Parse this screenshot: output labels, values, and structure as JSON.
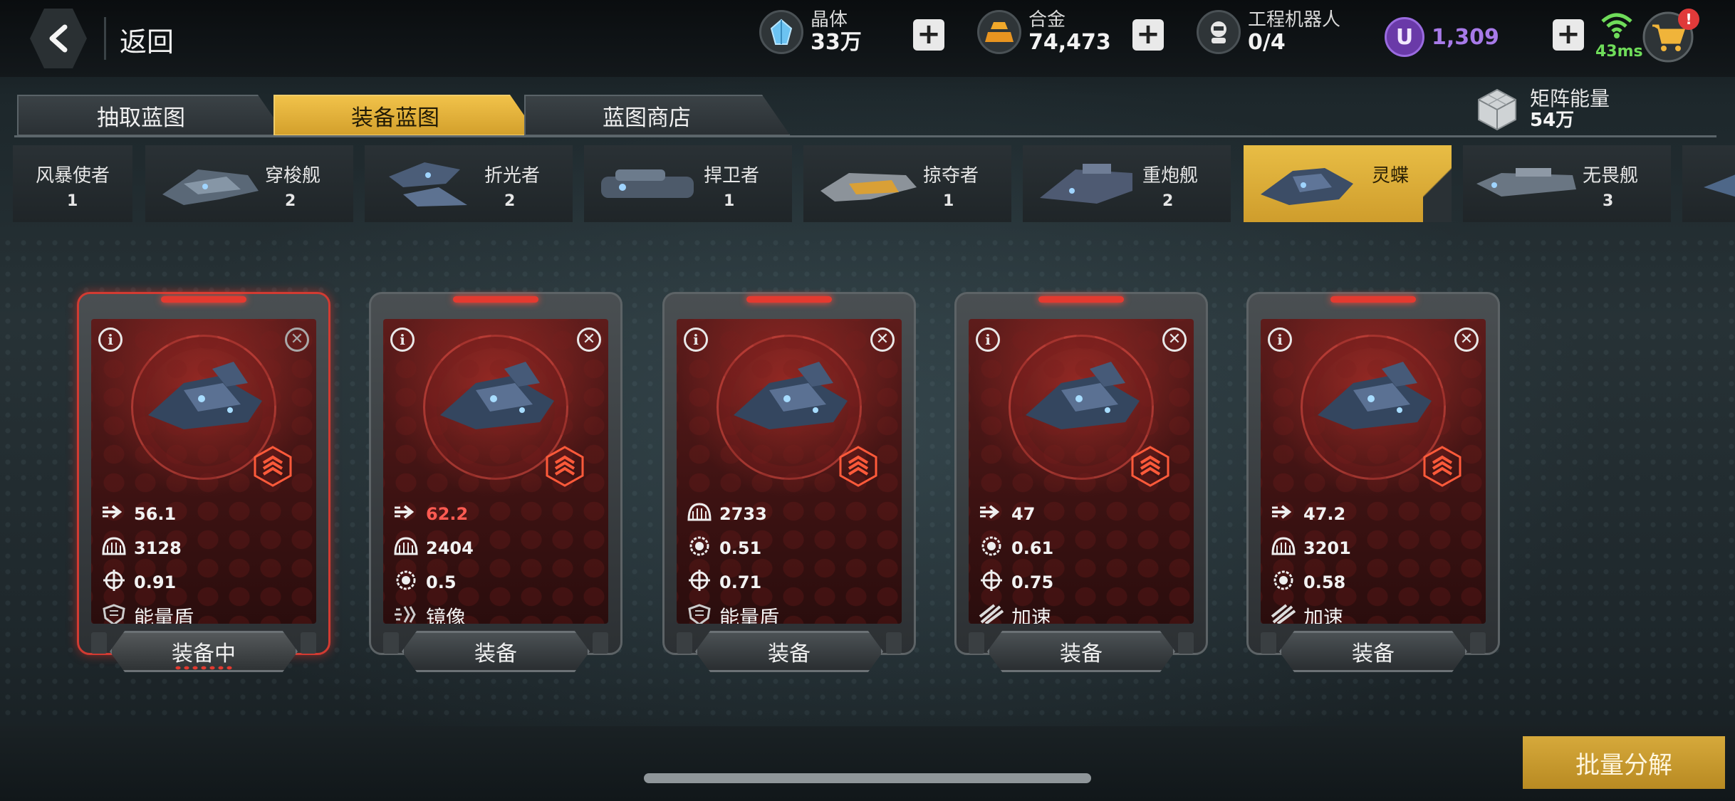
{
  "header": {
    "back_label": "返回",
    "resources": [
      {
        "name": "晶体",
        "value": "33万",
        "icon": "crystal-icon"
      },
      {
        "name": "合金",
        "value": "74,473",
        "icon": "alloy-icon"
      },
      {
        "name": "工程机器人",
        "value": "0/4",
        "icon": "robot-icon"
      }
    ],
    "premium": {
      "symbol": "U",
      "value": "1,309"
    },
    "plus": "+",
    "ping": "43ms",
    "cart_badge": "!"
  },
  "tabs": [
    {
      "label": "抽取蓝图",
      "active": false
    },
    {
      "label": "装备蓝图",
      "active": true
    },
    {
      "label": "蓝图商店",
      "active": false
    }
  ],
  "matrix_energy": {
    "name": "矩阵能量",
    "value": "54万"
  },
  "ships": [
    {
      "name": "风暴使者",
      "count": "1"
    },
    {
      "name": "穿梭舰",
      "count": "2"
    },
    {
      "name": "折光者",
      "count": "2"
    },
    {
      "name": "捍卫者",
      "count": "1"
    },
    {
      "name": "掠夺者",
      "count": "1"
    },
    {
      "name": "重炮舰",
      "count": "2"
    },
    {
      "name": "灵蝶",
      "count": "",
      "active": true
    },
    {
      "name": "无畏舰",
      "count": "3"
    }
  ],
  "cards": [
    {
      "equipped": true,
      "button": "装备中",
      "stats": [
        {
          "icon": "speed-icon",
          "value": "56.1"
        },
        {
          "icon": "armor-icon",
          "value": "3128"
        },
        {
          "icon": "crosshair-icon",
          "value": "0.91"
        }
      ],
      "skill": {
        "icon": "shield-icon",
        "label": "能量盾"
      }
    },
    {
      "equipped": false,
      "button": "装备",
      "stats": [
        {
          "icon": "speed-icon",
          "value": "62.2",
          "highlight": true
        },
        {
          "icon": "armor-icon",
          "value": "2404"
        },
        {
          "icon": "gear-icon",
          "value": "0.5"
        }
      ],
      "skill": {
        "icon": "mirror-icon",
        "label": "镜像"
      }
    },
    {
      "equipped": false,
      "button": "装备",
      "stats": [
        {
          "icon": "armor-icon",
          "value": "2733"
        },
        {
          "icon": "gear-icon",
          "value": "0.51"
        },
        {
          "icon": "crosshair-icon",
          "value": "0.71"
        }
      ],
      "skill": {
        "icon": "shield-icon",
        "label": "能量盾"
      }
    },
    {
      "equipped": false,
      "button": "装备",
      "stats": [
        {
          "icon": "speed-icon",
          "value": "47"
        },
        {
          "icon": "gear-icon",
          "value": "0.61"
        },
        {
          "icon": "crosshair-icon",
          "value": "0.75"
        }
      ],
      "skill": {
        "icon": "boost-icon",
        "label": "加速"
      }
    },
    {
      "equipped": false,
      "button": "装备",
      "stats": [
        {
          "icon": "speed-icon",
          "value": "47.2"
        },
        {
          "icon": "armor-icon",
          "value": "3201"
        },
        {
          "icon": "gear-icon",
          "value": "0.58"
        }
      ],
      "skill": {
        "icon": "boost-icon",
        "label": "加速"
      }
    }
  ],
  "bulk_button": "批量分解",
  "colors": {
    "accent_gold": "#e0b23d",
    "card_red": "#5e1c1b",
    "highlight_red": "#ff5b52",
    "ping_green": "#6fdc5a",
    "premium_purple": "#a77ae8"
  }
}
